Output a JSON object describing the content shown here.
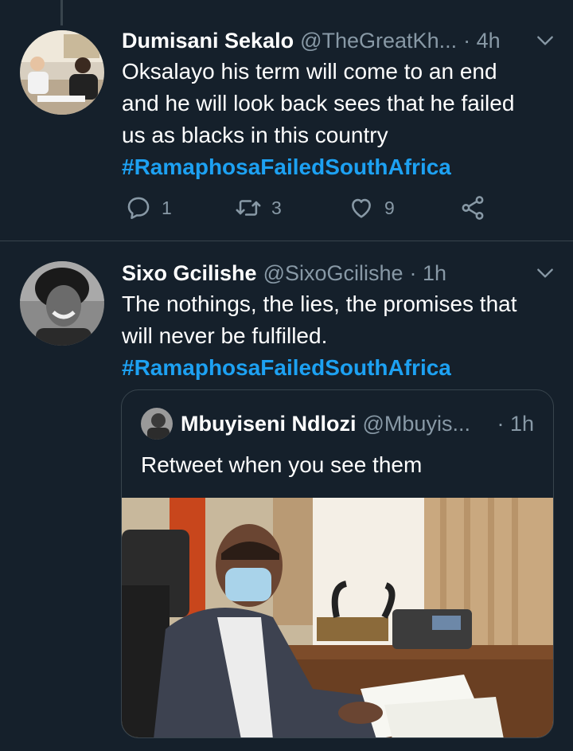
{
  "tweets": [
    {
      "author_name": "Dumisani Sekalo",
      "author_handle": "@TheGreatKh...",
      "time": "· 4h",
      "text_lines": [
        "Oksalayo his term will come to an end",
        "and he will look back sees that he failed",
        "us as blacks in this country"
      ],
      "hashtag": "#RamaphosaFailedSouthAfrica",
      "replies": "1",
      "retweets": "3",
      "likes": "9"
    },
    {
      "author_name": "Sixo Gcilishe",
      "author_handle": "@SixoGcilishe",
      "time": "· 1h",
      "text_lines": [
        "The nothings, the lies, the promises that",
        "will never be fulfilled."
      ],
      "hashtag": "#RamaphosaFailedSouthAfrica",
      "quoted": {
        "author_name": "Mbuyiseni Ndlozi",
        "author_handle": "@Mbuyis...",
        "time": "· 1h",
        "text": "Retweet when you see them"
      }
    }
  ],
  "icons": {
    "reply": "reply-icon",
    "retweet": "retweet-icon",
    "like": "heart-icon",
    "share": "share-icon",
    "more": "chevron-down-icon"
  },
  "colors": {
    "background": "#15202b",
    "divider": "#38444d",
    "hashtag": "#1da1f2",
    "secondary_text": "#8899a6"
  }
}
